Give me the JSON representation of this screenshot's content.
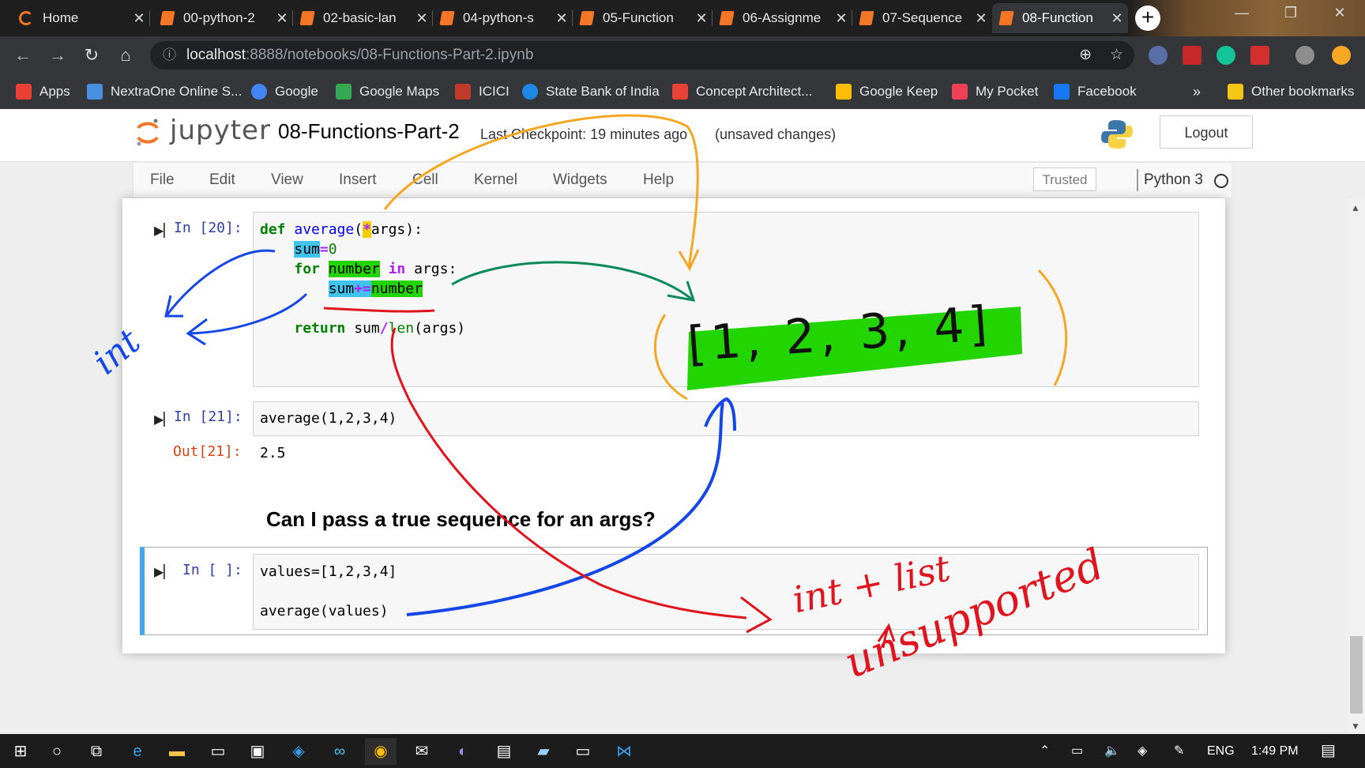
{
  "browser": {
    "tabs": [
      {
        "label": "Home",
        "icon": "jupyter-home-icon",
        "active": false
      },
      {
        "label": "00-python-2",
        "icon": "notebook-icon",
        "active": false
      },
      {
        "label": "02-basic-lan",
        "icon": "notebook-icon",
        "active": false
      },
      {
        "label": "04-python-s",
        "icon": "notebook-icon",
        "active": false
      },
      {
        "label": "05-Function",
        "icon": "notebook-icon",
        "active": false
      },
      {
        "label": "06-Assignme",
        "icon": "notebook-icon",
        "active": false
      },
      {
        "label": "07-Sequence",
        "icon": "notebook-icon",
        "active": false
      },
      {
        "label": "08-Function",
        "icon": "notebook-icon",
        "active": true
      }
    ],
    "close_glyph": "✕",
    "new_tab_glyph": "+",
    "window_controls": {
      "minimize": "—",
      "restore": "❐",
      "close": "✕"
    },
    "url_host": "localhost",
    "url_path": ":8888/notebooks/08-Functions-Part-2.ipynb",
    "bookmarks": [
      {
        "label": "Apps",
        "icon": "apps-grid-icon",
        "color": "#e94235"
      },
      {
        "label": "NextraOne Online S...",
        "icon": "nextraone-icon",
        "color": "#4a90e2"
      },
      {
        "label": "Google",
        "icon": "google-icon",
        "color": "#4285f4"
      },
      {
        "label": "Google Maps",
        "icon": "maps-icon",
        "color": "#34a853"
      },
      {
        "label": "ICICI",
        "icon": "icici-icon",
        "color": "#c0392b"
      },
      {
        "label": "State Bank of India",
        "icon": "sbi-icon",
        "color": "#1e88e5"
      },
      {
        "label": "Concept Architect...",
        "icon": "gmail-icon",
        "color": "#ea4335"
      },
      {
        "label": "Google Keep",
        "icon": "keep-icon",
        "color": "#fbbc04"
      },
      {
        "label": "My Pocket",
        "icon": "pocket-icon",
        "color": "#ef4056"
      },
      {
        "label": "Facebook",
        "icon": "facebook-icon",
        "color": "#1877f2"
      }
    ],
    "overflow": "»",
    "other_bookmarks": "Other bookmarks"
  },
  "jupyter": {
    "logo_text": "jupyter",
    "notebook_name": "08-Functions-Part-2",
    "checkpoint": "Last Checkpoint: 19 minutes ago",
    "unsaved": "(unsaved changes)",
    "logout": "Logout",
    "menu": [
      "File",
      "Edit",
      "View",
      "Insert",
      "Cell",
      "Kernel",
      "Widgets",
      "Help"
    ],
    "trusted": "Trusted",
    "kernel": "Python 3"
  },
  "cells": {
    "c1_prompt": "In [20]:",
    "c2_prompt": "In [21]:",
    "c2_code": "average(1,2,3,4)",
    "c2_out_prompt": "Out[21]:",
    "c2_output": "2.5",
    "heading": "Can I pass a true sequence for an args?",
    "c3_prompt": "In [ ]:",
    "c3_line1": "values=[1,2,3,4]",
    "c3_line2": "average(values)"
  },
  "annotations": {
    "list_text": "[1, 2, 3, 4]",
    "int_label": "int",
    "int_list_label": "int + list",
    "unsupported_label": "unsupported",
    "colors": {
      "blue": "#1447e6",
      "orange": "#f5a623",
      "green": "#0a8a5a",
      "red": "#e0141e",
      "highlight_green": "#22d400"
    }
  },
  "taskbar": {
    "tray_lang": "ENG",
    "clock": "1:49 PM"
  }
}
